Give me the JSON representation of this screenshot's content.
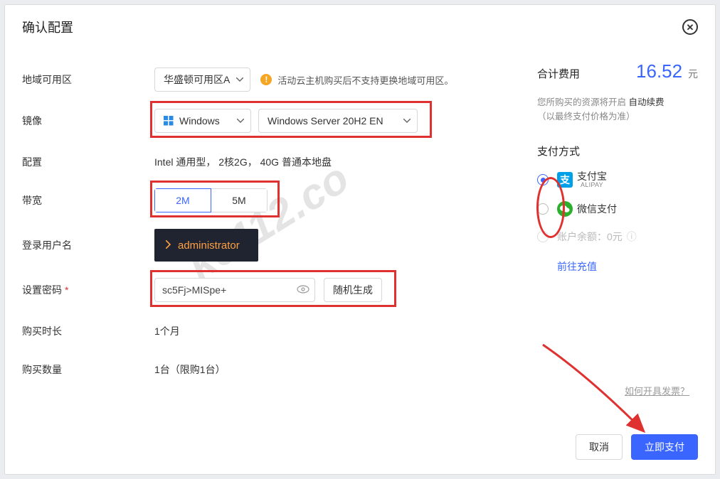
{
  "modal": {
    "title": "确认配置",
    "close_label": "✕"
  },
  "labels": {
    "region": "地域可用区",
    "image": "镜像",
    "config": "配置",
    "bandwidth": "带宽",
    "login_user": "登录用户名",
    "password": "设置密码",
    "duration": "购买时长",
    "quantity": "购买数量"
  },
  "region": {
    "selected": "华盛顿可用区A",
    "hint": "活动云主机购买后不支持更换地域可用区。"
  },
  "image": {
    "os": "Windows",
    "version": "Windows Server 20H2 EN"
  },
  "config_text": "Intel 通用型， 2核2G， 40G 普通本地盘",
  "bandwidth": {
    "options": [
      "2M",
      "5M"
    ],
    "active_index": 0
  },
  "login_user": "administrator",
  "password": {
    "value": "sc5Fj>MISpe+",
    "random_btn": "随机生成"
  },
  "duration_text": "1个月",
  "quantity_text": "1台（限购1台）",
  "cost": {
    "label": "合计费用",
    "value": "16.52",
    "unit": "元",
    "note_prefix": "您所购买的资源将开启 ",
    "note_bold": "自动续费",
    "note_suffix": "（以最终支付价格为准）"
  },
  "payment": {
    "title": "支付方式",
    "alipay": {
      "zh": "支付宝",
      "en": "ALIPAY"
    },
    "wechat": "微信支付",
    "balance_label": "账户余额：0元",
    "topup": "前往充值",
    "selected": "alipay"
  },
  "invoice_link": "如何开具发票？",
  "footer": {
    "cancel": "取消",
    "pay": "立即支付"
  },
  "icons": {
    "warn": "!",
    "info": "ⓘ"
  },
  "watermark": "ke112.co"
}
